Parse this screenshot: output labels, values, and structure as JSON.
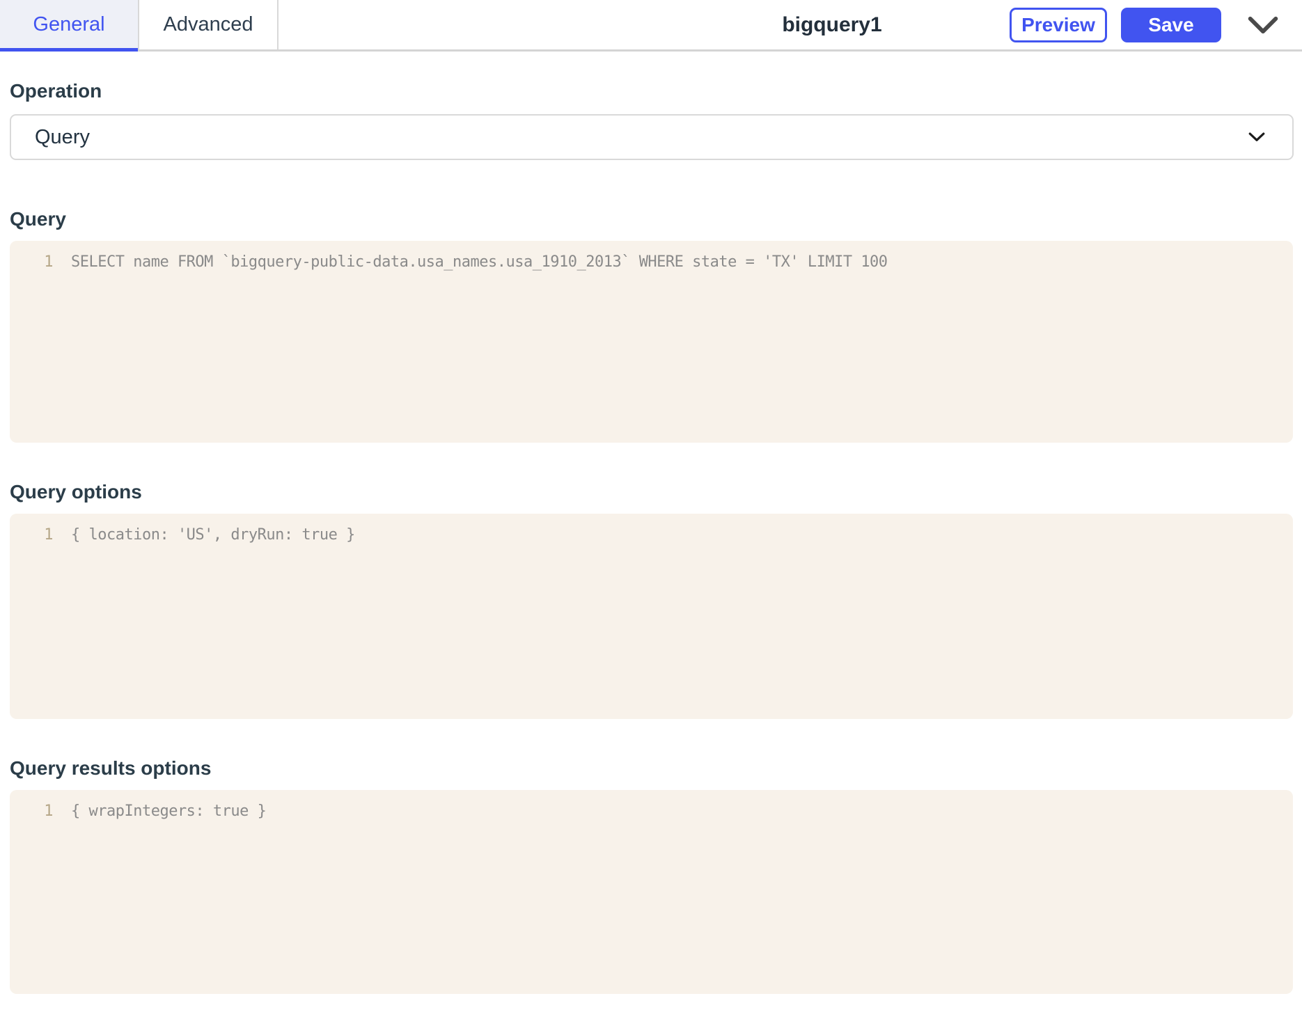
{
  "header": {
    "tabs": [
      {
        "label": "General",
        "active": true
      },
      {
        "label": "Advanced",
        "active": false
      }
    ],
    "title": "bigquery1",
    "preview_label": "Preview",
    "save_label": "Save"
  },
  "form": {
    "operation": {
      "label": "Operation",
      "value": "Query"
    },
    "sections": [
      {
        "label": "Query",
        "line_number": "1",
        "code": "SELECT name FROM `bigquery-public-data.usa_names.usa_1910_2013` WHERE state = 'TX' LIMIT 100"
      },
      {
        "label": "Query options",
        "line_number": "1",
        "code": "{ location: 'US', dryRun: true }"
      },
      {
        "label": "Query results options",
        "line_number": "1",
        "code": "{ wrapIntegers: true }"
      }
    ]
  },
  "colors": {
    "accent": "#4154F0",
    "active_tab_bg": "#EEF0F7",
    "editor_bg": "#F8F2EA",
    "line_number": "#B5A687",
    "code_text": "#8A8A8A"
  }
}
